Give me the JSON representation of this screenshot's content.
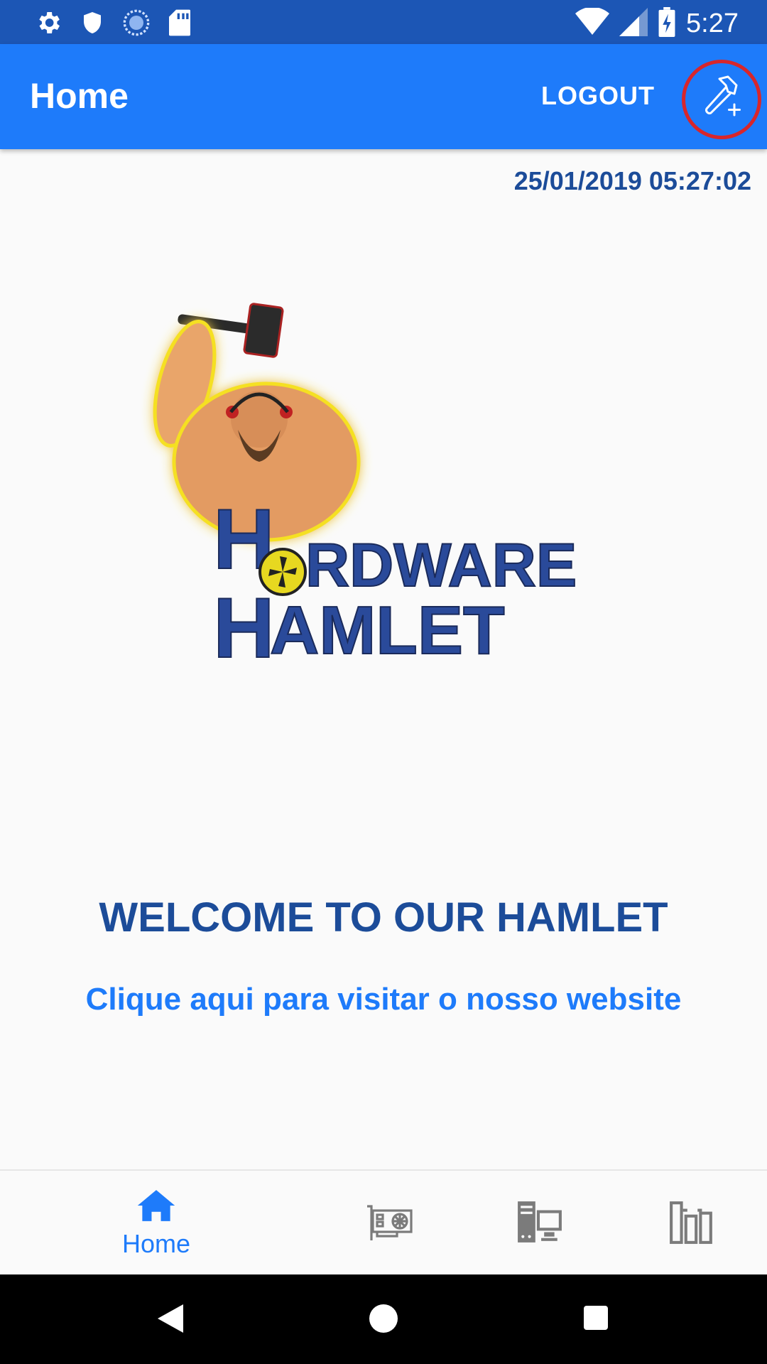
{
  "status_bar": {
    "time": "5:27",
    "icons_left": [
      "gear-icon",
      "shield-icon",
      "sync-icon",
      "sd-card-icon"
    ],
    "icons_right": [
      "wifi-icon",
      "signal-icon",
      "battery-charging-icon"
    ]
  },
  "app_bar": {
    "title": "Home",
    "logout_label": "LOGOUT",
    "action_icon": "tools-add-icon"
  },
  "main": {
    "timestamp": "25/01/2019 05:27:02",
    "logo_alt": "HARDWARE HAMLET",
    "welcome": "WELCOME TO OUR HAMLET",
    "link_text": "Clique aqui para visitar o nosso website"
  },
  "bottom_nav": {
    "items": [
      {
        "label": "Home",
        "icon": "home-icon",
        "active": true
      },
      {
        "label": "",
        "icon": "graphics-card-icon",
        "active": false
      },
      {
        "label": "",
        "icon": "desktop-computer-icon",
        "active": false
      },
      {
        "label": "",
        "icon": "components-icon",
        "active": false
      }
    ]
  },
  "colors": {
    "status_bar": "#1c56b5",
    "app_bar": "#1e7bfa",
    "heading": "#1c4c99",
    "link": "#1e7bfa",
    "highlight_circle": "#d8262b"
  }
}
